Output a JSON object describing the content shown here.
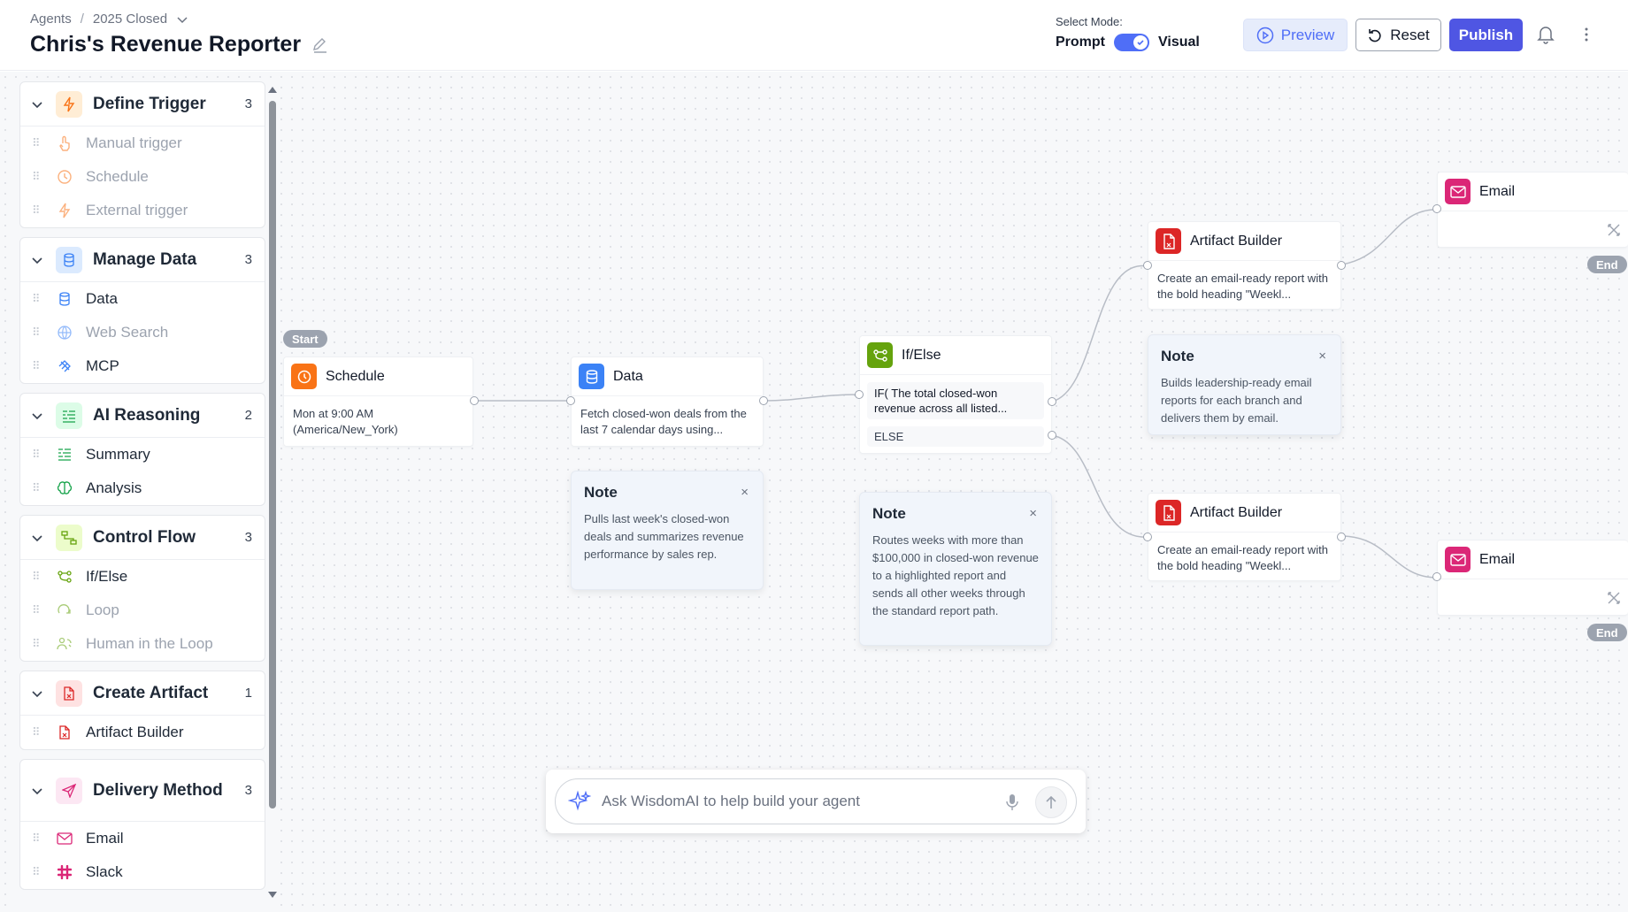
{
  "breadcrumb": {
    "root": "Agents",
    "separator": "/",
    "current": "2025 Closed"
  },
  "title": "Chris's Revenue Reporter",
  "mode": {
    "label": "Select Mode:",
    "left": "Prompt",
    "right": "Visual"
  },
  "toolbar": {
    "preview": "Preview",
    "reset": "Reset",
    "publish": "Publish"
  },
  "sidebar": {
    "sections": [
      {
        "title": "Define Trigger",
        "count": "3",
        "items": [
          "Manual trigger",
          "Schedule",
          "External trigger"
        ]
      },
      {
        "title": "Manage Data",
        "count": "3",
        "items": [
          "Data",
          "Web Search",
          "MCP"
        ]
      },
      {
        "title": "AI Reasoning",
        "count": "2",
        "items": [
          "Summary",
          "Analysis"
        ]
      },
      {
        "title": "Control Flow",
        "count": "3",
        "items": [
          "If/Else",
          "Loop",
          "Human in the Loop"
        ]
      },
      {
        "title": "Create Artifact",
        "count": "1",
        "items": [
          "Artifact Builder"
        ]
      },
      {
        "title": "Delivery Method",
        "count": "3",
        "items": [
          "Email",
          "Slack"
        ]
      }
    ]
  },
  "flow": {
    "start": "Start",
    "end": "End",
    "schedule": {
      "title": "Schedule",
      "body": "Mon at 9:00 AM (America/New_York)"
    },
    "data": {
      "title": "Data",
      "body": "Fetch closed-won deals from the last 7 calendar days using..."
    },
    "ifelse": {
      "title": "If/Else",
      "condition": "IF( The total closed-won revenue across all listed...",
      "else": "ELSE"
    },
    "artifact_top": {
      "title": "Artifact Builder",
      "body": "Create an email-ready report with the bold heading \"Weekl..."
    },
    "artifact_bottom": {
      "title": "Artifact Builder",
      "body": "Create an email-ready report with the bold heading \"Weekl..."
    },
    "email_top": {
      "title": "Email"
    },
    "email_bottom": {
      "title": "Email"
    },
    "notes": [
      {
        "title": "Note",
        "body": "Pulls last week's closed-won deals and summarizes revenue performance by sales rep."
      },
      {
        "title": "Note",
        "body": "Routes weeks with more than $100,000 in closed-won revenue to a highlighted report and sends all other weeks through the standard report path."
      },
      {
        "title": "Note",
        "body": "Builds leadership-ready email reports for each branch and delivers them by email."
      }
    ],
    "close_glyph": "×"
  },
  "chat": {
    "placeholder": "Ask WisdomAI to help build your agent"
  },
  "colors": {
    "accent": "#4f56e3",
    "trigger": "#f97316",
    "data": "#3b82f6",
    "control": "#65a30d",
    "artifact": "#dc2626",
    "email": "#db2777"
  }
}
